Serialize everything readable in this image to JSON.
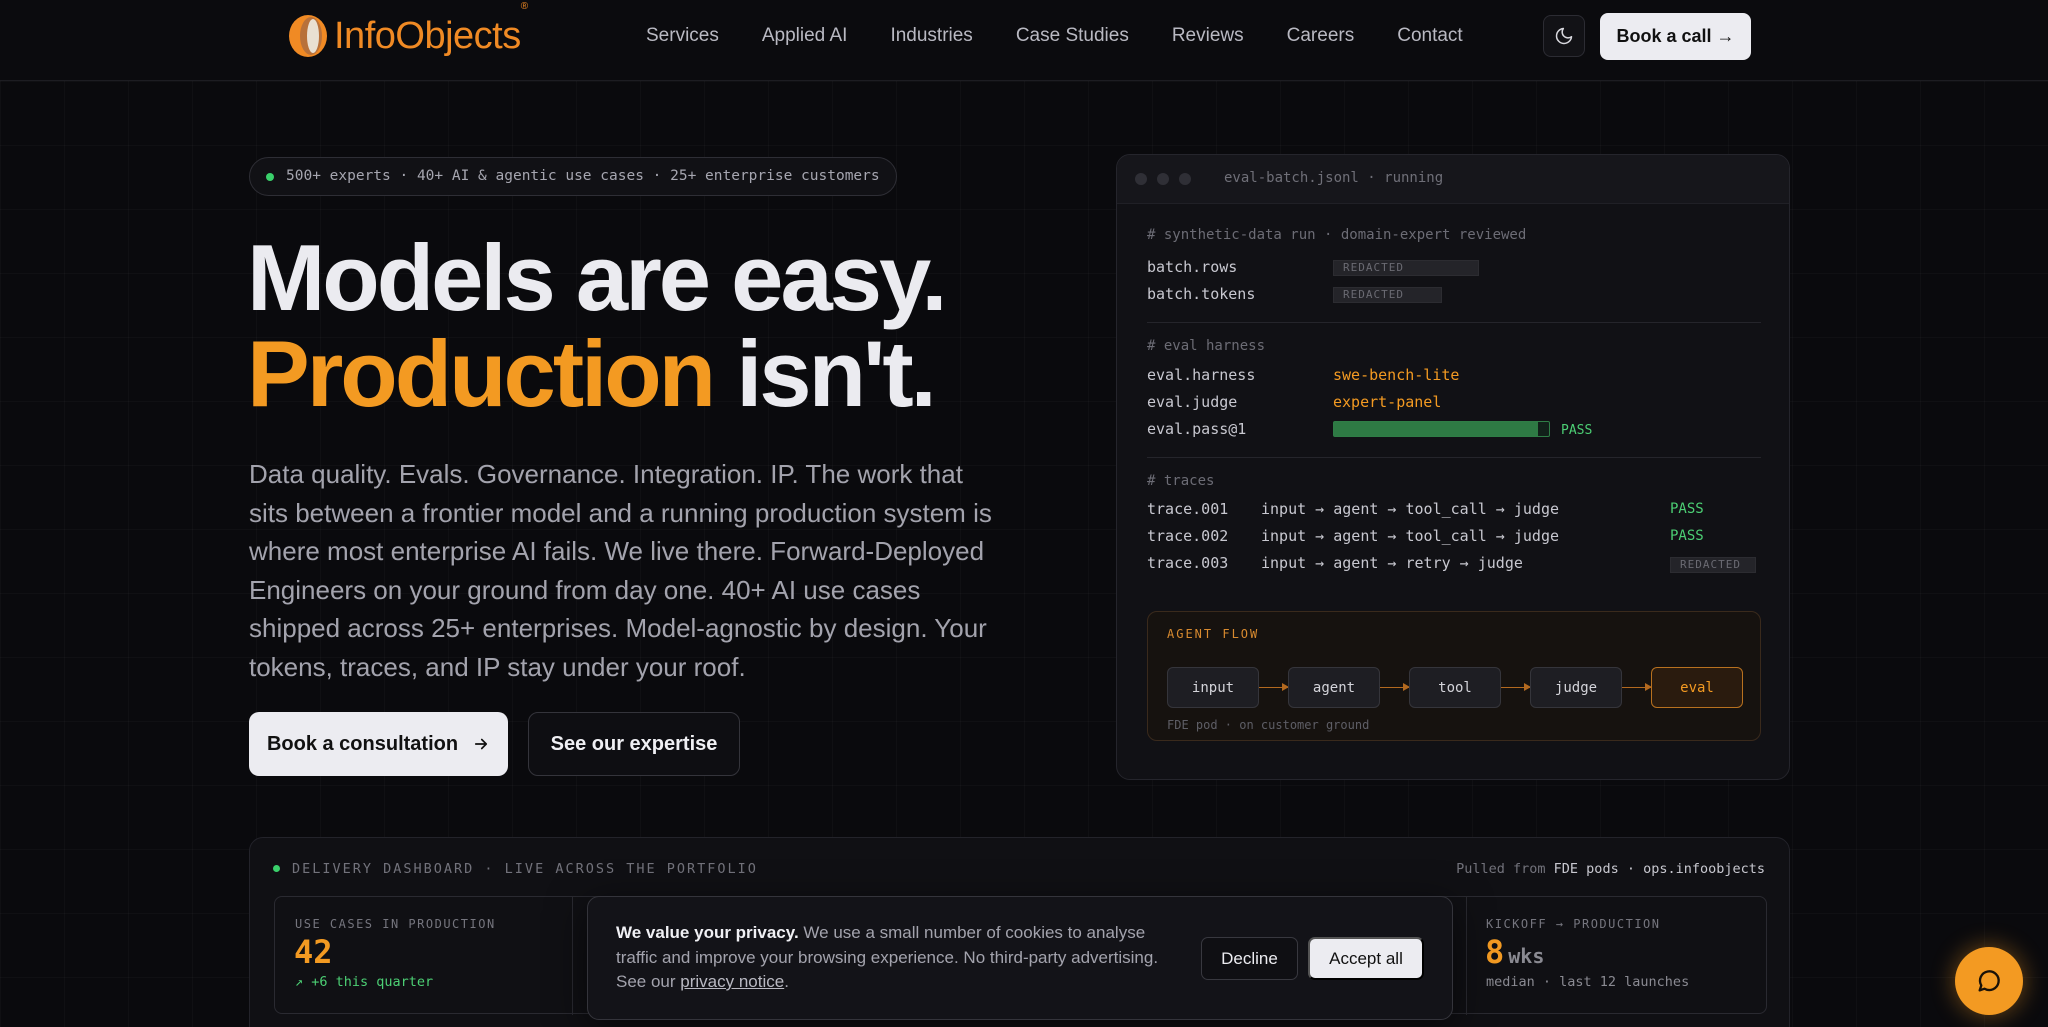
{
  "nav": {
    "logo_text": "InfoObjects",
    "logo_reg": "®",
    "links": [
      "Services",
      "Applied AI",
      "Industries",
      "Case Studies",
      "Reviews",
      "Careers",
      "Contact"
    ],
    "theme_icon": "moon-icon",
    "cta": "Book a call →"
  },
  "hero": {
    "badge": "500+ experts · 40+ AI & agentic use cases · 25+ enterprise customers",
    "headline_line1": "Models are easy.",
    "headline_accent": "Production",
    "headline_rest": " isn't.",
    "lede": "Data quality. Evals. Governance. Integration. IP. The work that sits between a frontier model and a running production system is where most enterprise AI fails. We live there. Forward-Deployed Engineers on your ground from day one. 40+ AI use cases shipped across 25+ enterprises. Model-agnostic by design. Your tokens, traces, and IP stay under your roof.",
    "primary_cta": "Book a consultation",
    "primary_cta_icon": "arrow-right-icon",
    "secondary_cta": "See our expertise",
    "accent_color": "#f39a22"
  },
  "terminal": {
    "title": "eval-batch.jsonl · running",
    "comment1": "# synthetic-data run · domain-expert reviewed",
    "batch_rows_key": "batch.rows",
    "batch_tokens_key": "batch.tokens",
    "redacted": "REDACTED",
    "comment2": "# eval harness",
    "harness_key": "eval.harness",
    "harness_val": "swe-bench-lite",
    "judge_key": "eval.judge",
    "judge_val": "expert-panel",
    "pass_key": "eval.pass@1",
    "pass_fraction": 0.95,
    "pass_label": "PASS",
    "comment3": "# traces",
    "traces": [
      {
        "id": "trace.001",
        "path": "input → agent → tool_call → judge",
        "status": "PASS"
      },
      {
        "id": "trace.002",
        "path": "input → agent → tool_call → judge",
        "status": "PASS"
      },
      {
        "id": "trace.003",
        "path": "input → agent → retry → judge",
        "status": "REDACTED"
      }
    ],
    "flow": {
      "title": "AGENT FLOW",
      "nodes": [
        "input",
        "agent",
        "tool",
        "judge",
        "eval"
      ],
      "footer": "FDE pod · on customer ground"
    }
  },
  "dashboard": {
    "title": "DELIVERY DASHBOARD · LIVE ACROSS THE PORTFOLIO",
    "source_prefix": "Pulled from ",
    "source_strong": "FDE pods · ops.infoobjects",
    "card1": {
      "label": "USE CASES IN PRODUCTION",
      "value": "42",
      "sub": "↗ +6 this quarter"
    },
    "card_last": {
      "label": "KICKOFF → PRODUCTION",
      "value": "8",
      "unit": "wks",
      "sub": "median · last 12 launches"
    }
  },
  "cookie": {
    "title": "We value your privacy.",
    "body": " We use a small number of cookies to analyse traffic and improve your browsing experience. No third-party advertising. See our ",
    "link": "privacy notice",
    "end": ".",
    "decline": "Decline",
    "accept": "Accept all"
  },
  "chat": {
    "icon": "chat-bubble-icon"
  }
}
